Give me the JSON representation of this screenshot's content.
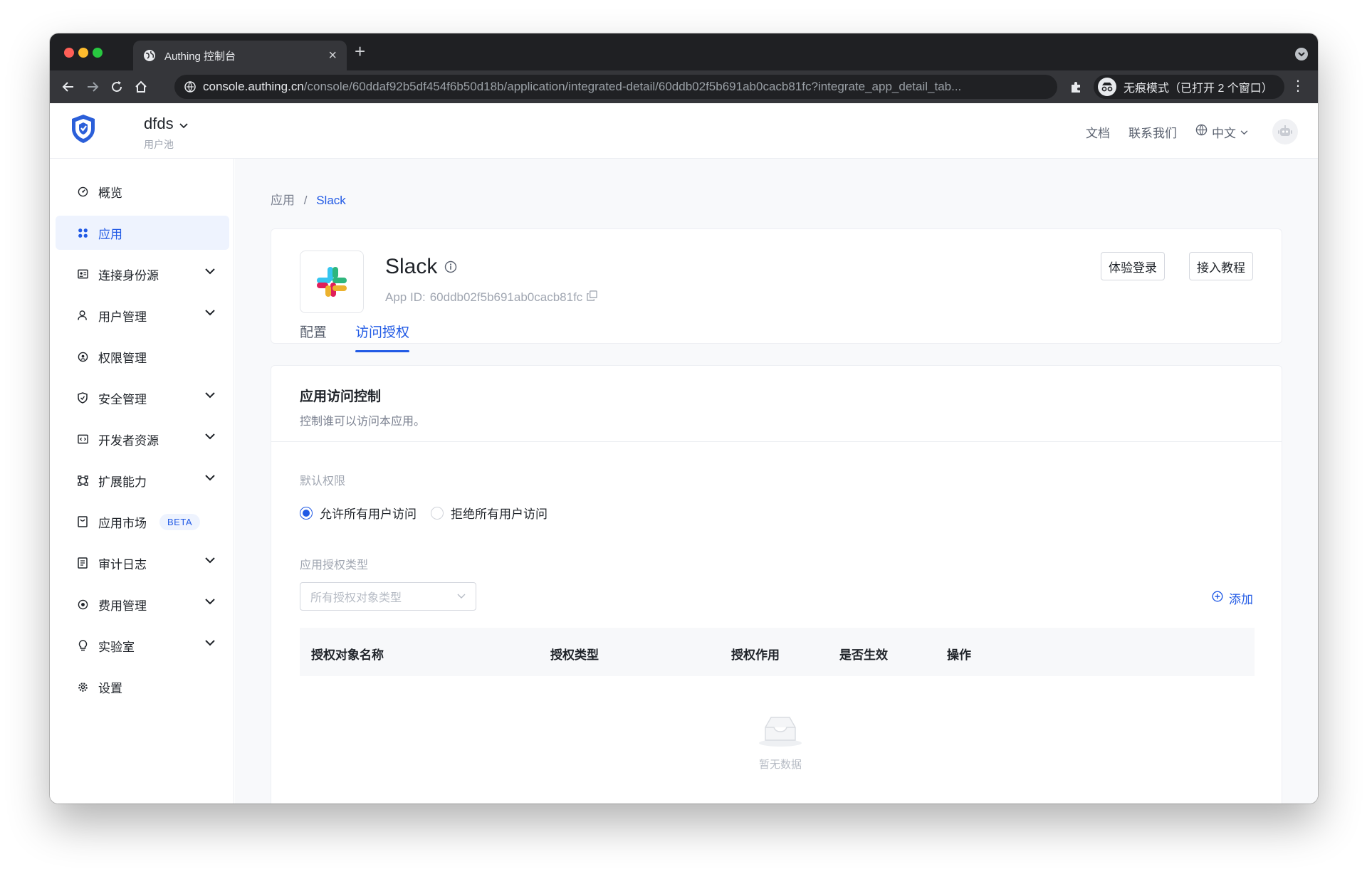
{
  "browser": {
    "tab_title": "Authing 控制台",
    "url_host": "console.authing.cn",
    "url_path": "/console/60ddaf92b5df454f6b50d18b/application/integrated-detail/60ddb02f5b691ab0cacb81fc?integrate_app_detail_tab...",
    "incognito_label": "无痕模式（已打开 2 个窗口）"
  },
  "header": {
    "pool_name": "dfds",
    "pool_sub": "用户池",
    "links": [
      "文档",
      "联系我们"
    ],
    "language": "中文"
  },
  "sidebar": {
    "items": [
      {
        "label": "概览",
        "icon": "dashboard-icon",
        "expandable": false,
        "active": false
      },
      {
        "label": "应用",
        "icon": "apps-icon",
        "expandable": false,
        "active": true
      },
      {
        "label": "连接身份源",
        "icon": "id-card-icon",
        "expandable": true,
        "active": false
      },
      {
        "label": "用户管理",
        "icon": "user-icon",
        "expandable": true,
        "active": false
      },
      {
        "label": "权限管理",
        "icon": "permission-icon",
        "expandable": false,
        "active": false
      },
      {
        "label": "安全管理",
        "icon": "shield-icon",
        "expandable": true,
        "active": false
      },
      {
        "label": "开发者资源",
        "icon": "code-icon",
        "expandable": true,
        "active": false
      },
      {
        "label": "扩展能力",
        "icon": "extension-icon",
        "expandable": true,
        "active": false
      },
      {
        "label": "应用市场",
        "icon": "market-icon",
        "expandable": false,
        "active": false,
        "badge": "BETA"
      },
      {
        "label": "审计日志",
        "icon": "log-icon",
        "expandable": true,
        "active": false
      },
      {
        "label": "费用管理",
        "icon": "billing-icon",
        "expandable": true,
        "active": false
      },
      {
        "label": "实验室",
        "icon": "bulb-icon",
        "expandable": true,
        "active": false
      },
      {
        "label": "设置",
        "icon": "gear-icon",
        "expandable": false,
        "active": false
      }
    ]
  },
  "breadcrumb": {
    "parent": "应用",
    "separator": "/",
    "current": "Slack"
  },
  "app": {
    "name": "Slack",
    "app_id_label": "App ID:",
    "app_id": "60ddb02f5b691ab0cacb81fc",
    "buttons": {
      "try_login": "体验登录",
      "tutorial": "接入教程"
    },
    "tabs": [
      {
        "label": "配置",
        "active": false
      },
      {
        "label": "访问授权",
        "active": true
      }
    ]
  },
  "access": {
    "title": "应用访问控制",
    "description": "控制谁可以访问本应用。",
    "default_permission_label": "默认权限",
    "radio_allow": "允许所有用户访问",
    "radio_deny": "拒绝所有用户访问",
    "selected": "allow",
    "auth_type_label": "应用授权类型",
    "select_placeholder": "所有授权对象类型",
    "add_label": "添加",
    "table_headers": [
      "授权对象名称",
      "授权类型",
      "授权作用",
      "是否生效",
      "操作"
    ],
    "empty_text": "暂无数据"
  },
  "colors": {
    "primary": "#215ae5",
    "active_bg": "#eef3fe",
    "brand_logo": "#2b5fd9"
  }
}
